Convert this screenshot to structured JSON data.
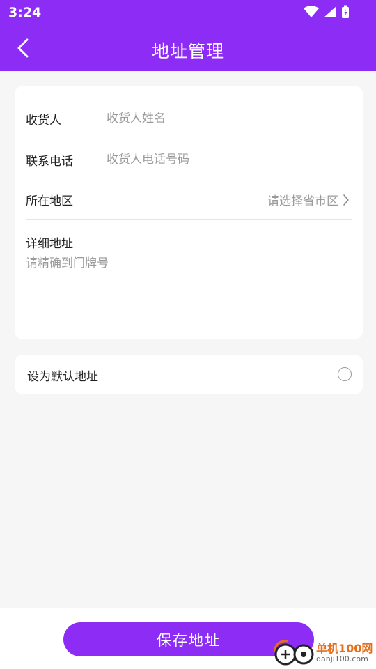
{
  "status_bar": {
    "time": "3:24"
  },
  "app_bar": {
    "title": "地址管理"
  },
  "form": {
    "recipient": {
      "label": "收货人",
      "placeholder": "收货人姓名",
      "value": ""
    },
    "phone": {
      "label": "联系电话",
      "placeholder": "收货人电话号码",
      "value": ""
    },
    "region": {
      "label": "所在地区",
      "placeholder": "请选择省市区"
    },
    "detail": {
      "label": "详细地址",
      "placeholder": "请精确到门牌号",
      "value": ""
    }
  },
  "default_address": {
    "label": "设为默认地址",
    "checked": false
  },
  "save_button": {
    "label": "保存地址"
  },
  "watermark": {
    "name": "单机100网",
    "url": "danji100.com"
  },
  "colors": {
    "primary": "#8c2cf5",
    "background": "#f6f6f6"
  }
}
